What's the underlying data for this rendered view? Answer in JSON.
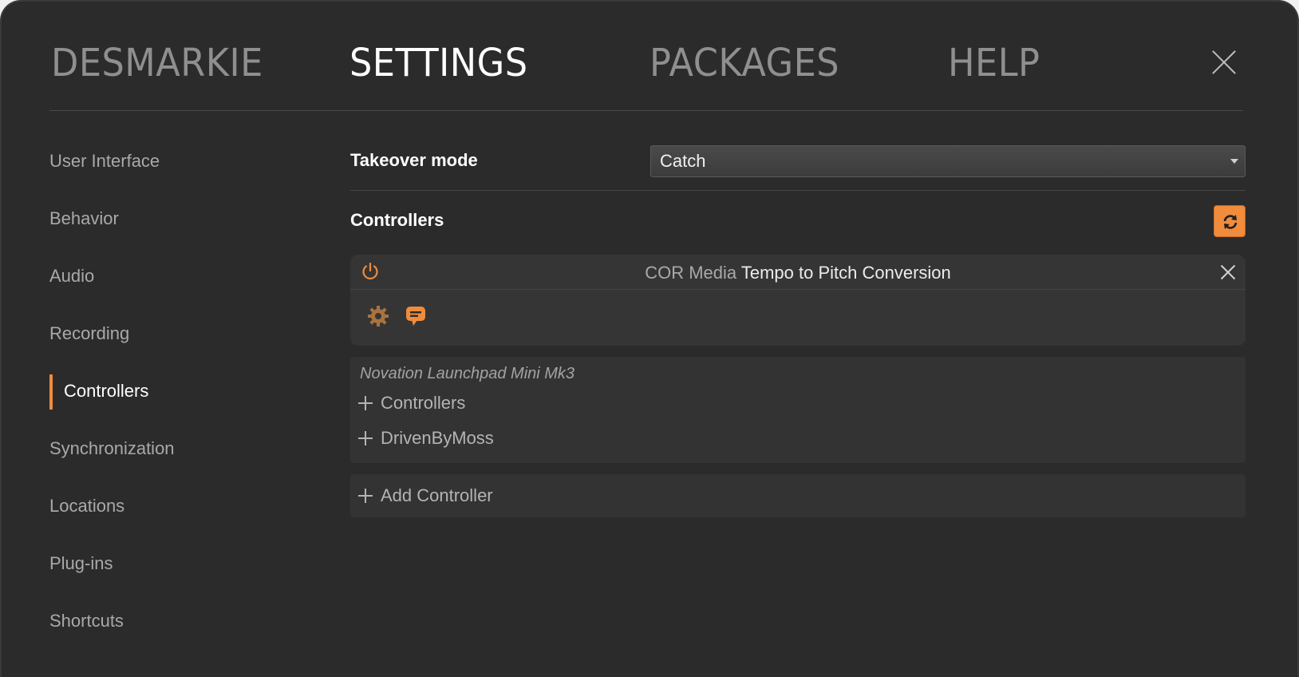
{
  "nav": {
    "tabs": [
      {
        "label": "DESMARKIE",
        "active": false
      },
      {
        "label": "SETTINGS",
        "active": true
      },
      {
        "label": "PACKAGES",
        "active": false
      },
      {
        "label": "HELP",
        "active": false
      }
    ],
    "close_icon": "close-icon"
  },
  "sidebar": {
    "items": [
      {
        "label": "User Interface"
      },
      {
        "label": "Behavior"
      },
      {
        "label": "Audio"
      },
      {
        "label": "Recording"
      },
      {
        "label": "Controllers",
        "active": true
      },
      {
        "label": "Synchronization"
      },
      {
        "label": "Locations"
      },
      {
        "label": "Plug-ins"
      },
      {
        "label": "Shortcuts"
      }
    ]
  },
  "main": {
    "takeover": {
      "label": "Takeover mode",
      "value": "Catch"
    },
    "controllers_label": "Controllers",
    "refresh_icon": "refresh-icon",
    "controller_card": {
      "vendor": "COR Media",
      "name": "Tempo to Pitch Conversion",
      "icons": [
        "power-icon",
        "gear-icon",
        "message-icon",
        "close-icon"
      ]
    },
    "device": {
      "name": "Novation Launchpad Mini Mk3",
      "sections": [
        "Controllers",
        "DrivenByMoss"
      ]
    },
    "add_controller": "Add Controller"
  },
  "colors": {
    "accent": "#f08c3c",
    "background": "#2b2b2b",
    "panel": "#353535"
  }
}
